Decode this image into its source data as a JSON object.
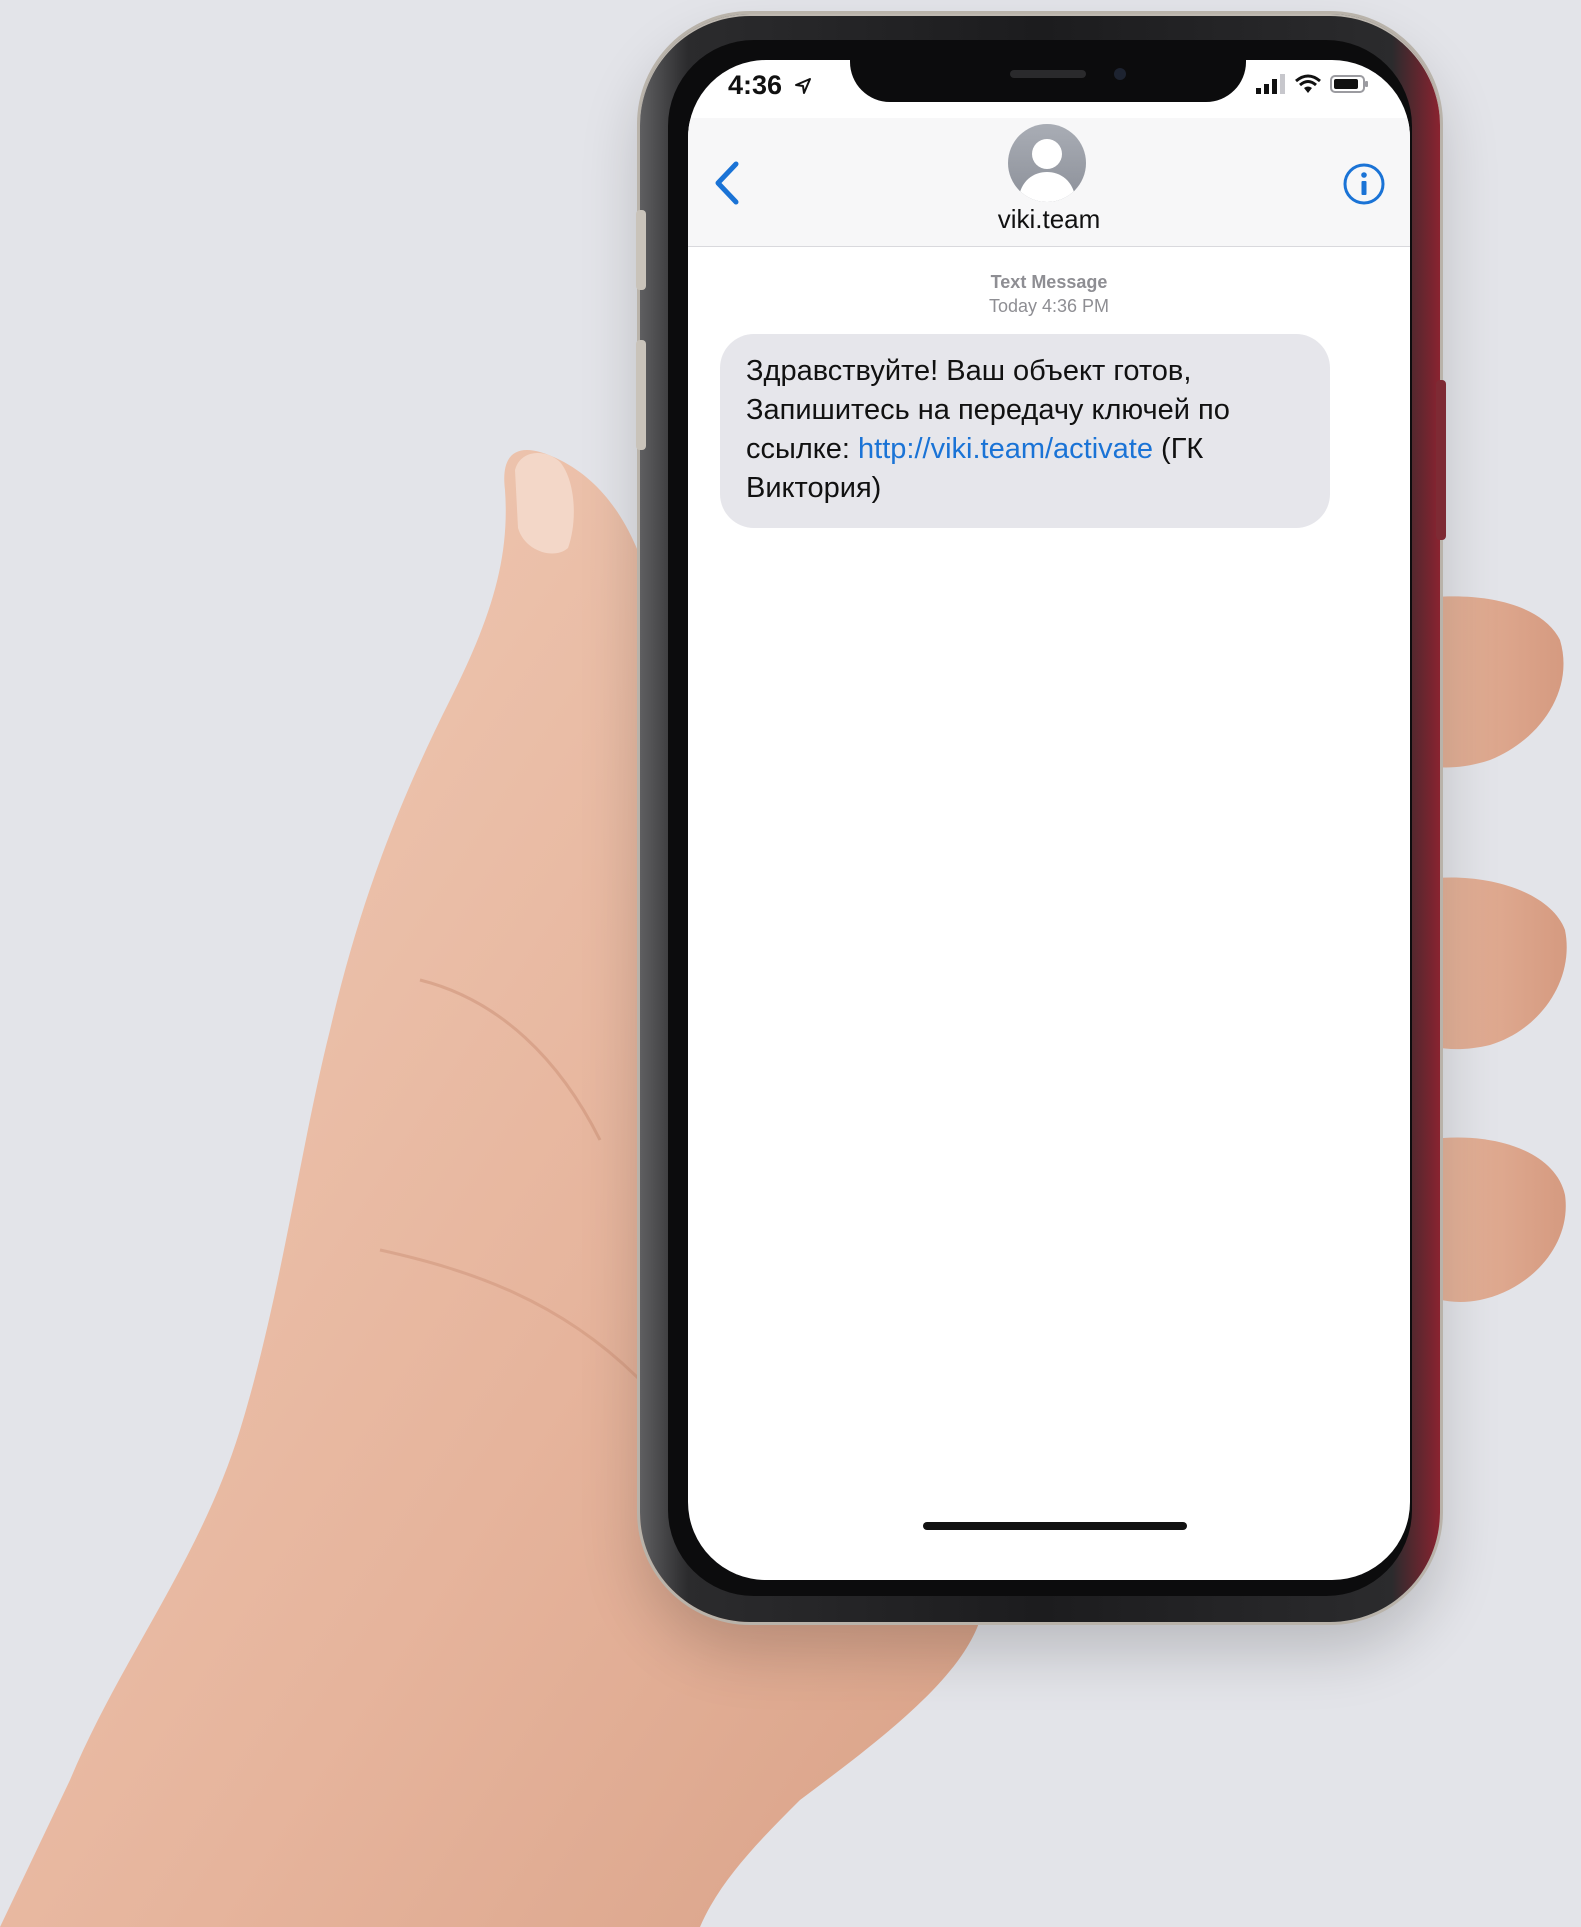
{
  "status_bar": {
    "time": "4:36"
  },
  "contact": {
    "name": "viki.team"
  },
  "conversation": {
    "meta_label": "Text Message",
    "meta_time": "Today 4:36 PM",
    "message": {
      "text_before": "Здравствуйте! Ваш объект готов, Запишитесь на передачу ключей по ссылке: ",
      "link": "http://viki.team/activate",
      "text_after": " (ГК Виктория)"
    }
  },
  "colors": {
    "accent": "#1a73d6",
    "bubble": "#e6e6eb",
    "background": "#e3e4e9"
  },
  "icons": [
    "back-chevron-icon",
    "info-icon",
    "signal-icon",
    "wifi-icon",
    "battery-icon",
    "location-arrow-icon",
    "contact-avatar-icon"
  ]
}
